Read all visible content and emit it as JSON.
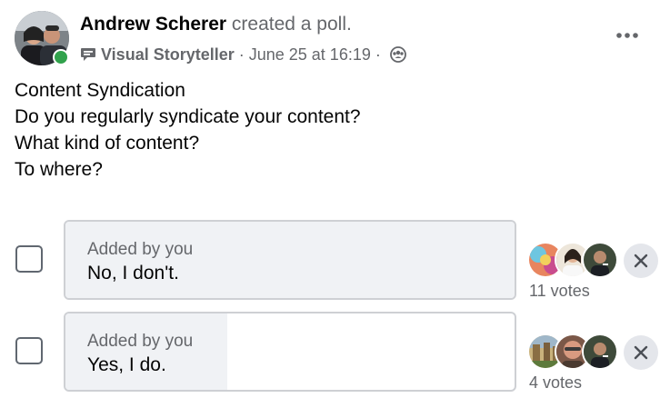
{
  "post": {
    "author": "Andrew Scherer",
    "action": " created a poll.",
    "badge_label": "Visual Storyteller",
    "badge_icon": "speech-bubble-badge-icon",
    "separator": "·",
    "date": "June 25 at 16:19",
    "audience_icon": "group-audience-icon",
    "more_icon": "more-horizontal-icon",
    "text_lines": [
      "Content Syndication",
      "Do you regularly syndicate your content?",
      "What kind of content?",
      "To where?"
    ]
  },
  "poll": {
    "options": [
      {
        "added_by": "Added by you",
        "label": "No, I don't.",
        "votes_label": "11 votes",
        "vote_share": 1.0,
        "checked": false
      },
      {
        "added_by": "Added by you",
        "label": "Yes, I do.",
        "votes_label": "4 votes",
        "vote_share": 0.36,
        "checked": false
      }
    ]
  },
  "colors": {
    "online_status": "#31a24c",
    "secondary_text": "#65676b",
    "option_fill": "#f0f2f5",
    "option_border": "#ced0d4",
    "remove_button_bg": "#e4e6eb"
  }
}
